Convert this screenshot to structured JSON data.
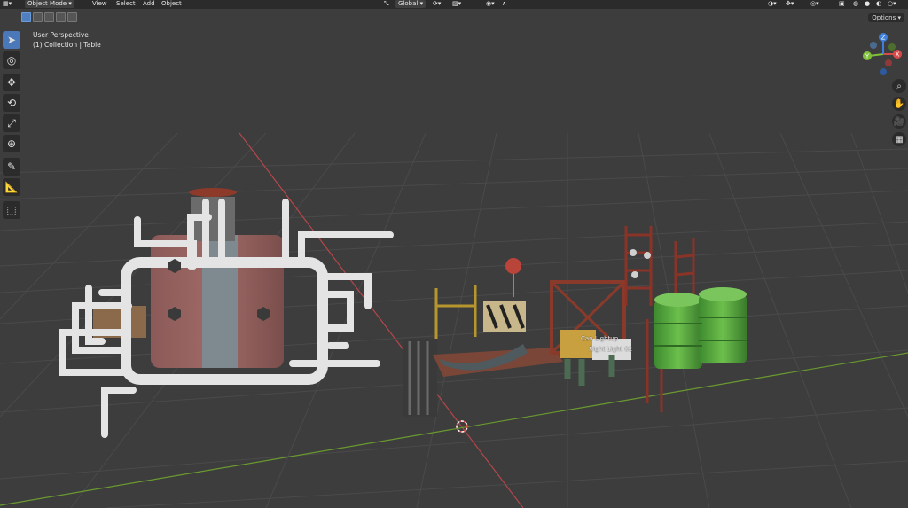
{
  "header": {
    "editor_icon": "viewport-icon",
    "mode": "Object Mode",
    "menu": [
      "View",
      "Select",
      "Add",
      "Object"
    ],
    "transform_orientation": "Global"
  },
  "overlay": {
    "perspective_label": "User Perspective",
    "collection_label": "(1) Collection | Table"
  },
  "options_label": "Options",
  "scene_labels": {
    "label_a": "Can Lightup",
    "label_b": "Right Light 02"
  },
  "gizmo": {
    "axis_x": "X",
    "axis_y": "Y",
    "axis_z": "Z"
  },
  "colors": {
    "x_axis": "#d84a4a",
    "y_axis": "#7fbf3a",
    "z_axis": "#3c7fdc",
    "accent": "#4a78b9"
  }
}
